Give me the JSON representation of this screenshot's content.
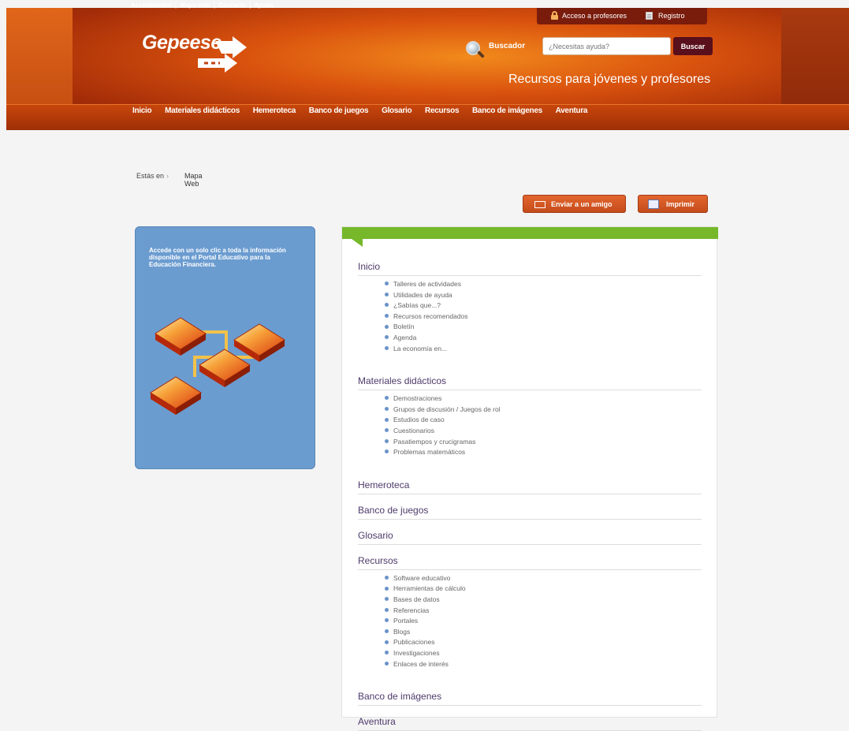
{
  "header": {
    "toplinks": [
      "Accesibilidad",
      "Mapa web",
      "Contacto",
      "Ayuda"
    ],
    "toplinks_sep": "|",
    "access_label": "Acceso a profesores",
    "register_label": "Registro",
    "logo": "Gepeese",
    "search_label": "Buscador",
    "search_placeholder": "¿Necesitas ayuda?",
    "search_button": "Buscar",
    "tagline": "Recursos para jóvenes y profesores"
  },
  "nav": [
    "Inicio",
    "Materiales didácticos",
    "Hemeroteca",
    "Banco de juegos",
    "Glosario",
    "Recursos",
    "Banco de imágenes",
    "Aventura"
  ],
  "breadcrumb": {
    "label": "Estás en",
    "current": "Mapa Web"
  },
  "actions": {
    "send": "Enviar a un amigo",
    "print": "Imprimir"
  },
  "sidebar": {
    "text": "Accede con un solo clic a toda la información disponible en el Portal Educativo para la Educación Financiera."
  },
  "sitemap": [
    {
      "title": "Inicio",
      "items": [
        "Talleres de actividades",
        "Utilidades de ayuda",
        "¿Sabías que...?",
        "Recursos recomendados",
        "Boletín",
        "Agenda",
        "La economía en..."
      ]
    },
    {
      "title": "Materiales didácticos",
      "items": [
        "Demostraciones",
        "Grupos de discusión / Juegos de rol",
        "Estudios de caso",
        "Cuestionarios",
        "Pasatiempos y crucigramas",
        "Problemas matemáticos"
      ]
    },
    {
      "title": "Hemeroteca",
      "items": []
    },
    {
      "title": "Banco de juegos",
      "items": []
    },
    {
      "title": "Glosario",
      "items": []
    },
    {
      "title": "Recursos",
      "items": [
        "Software educativo",
        "Herramientas de cálculo",
        "Bases de datos",
        "Referencias",
        "Portales",
        "Blogs",
        "Publicaciones",
        "Investigaciones",
        "Enlaces de interés"
      ]
    },
    {
      "title": "Banco de imágenes",
      "items": []
    },
    {
      "title": "Aventura",
      "items": []
    }
  ],
  "colors": {
    "accent_green": "#76b82a",
    "header_orange": "#d9520e",
    "panel_blue": "#6b9cd0",
    "section_purple": "#4e3a6a"
  }
}
